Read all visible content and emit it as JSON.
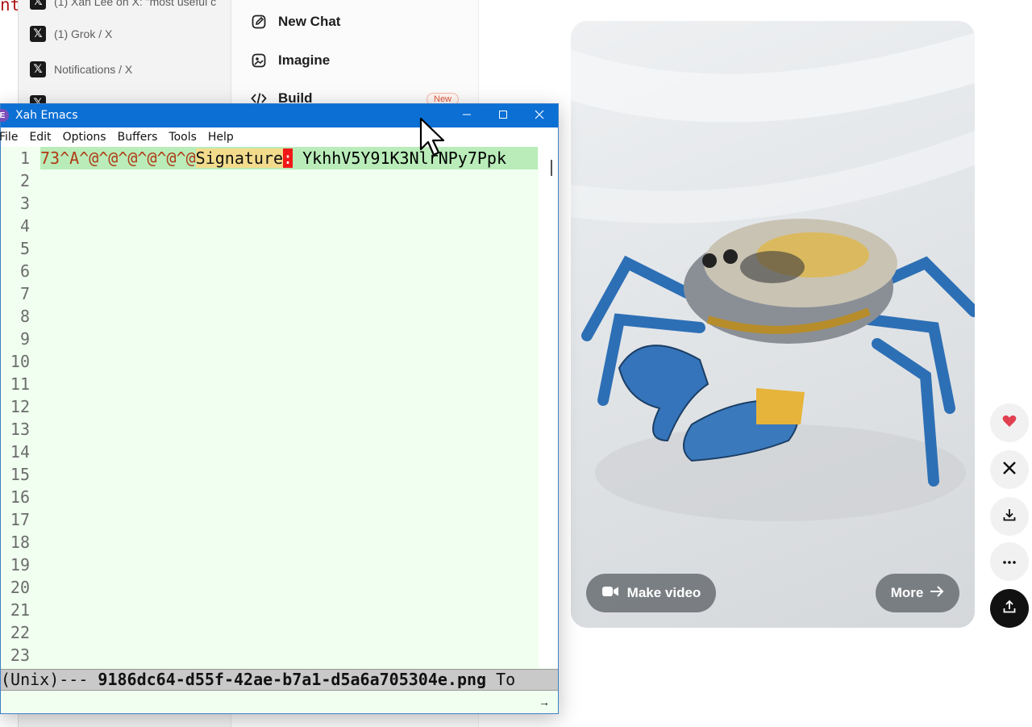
{
  "background": {
    "left_fragment": "nt",
    "tabs": [
      {
        "title": "(1) Xah Lee on X: \"most useful c",
        "icon": "x-logo-icon"
      },
      {
        "title": "(1) Grok / X",
        "icon": "x-logo-icon"
      },
      {
        "title": "Notifications / X",
        "icon": "x-logo-icon"
      },
      {
        "title": "",
        "icon": "x-logo-icon"
      }
    ],
    "grok_nav": [
      {
        "label": "New Chat",
        "icon": "edit-icon"
      },
      {
        "label": "Imagine",
        "icon": "imagine-icon"
      },
      {
        "label": "Build",
        "icon": "code-icon",
        "badge": "New"
      }
    ],
    "image_card": {
      "make_video_label": "Make video",
      "more_label": "More"
    },
    "side_actions": [
      "heart-icon",
      "x-share-icon",
      "download-icon",
      "more-dots-icon",
      "upload-icon"
    ]
  },
  "emacs": {
    "title": "Xah Emacs",
    "menu": [
      "File",
      "Edit",
      "Options",
      "Buffers",
      "Tools",
      "Help"
    ],
    "line_numbers": [
      "1",
      "2",
      "3",
      "4",
      "5",
      "6",
      "7",
      "8",
      "9",
      "10",
      "11",
      "12",
      "13",
      "14",
      "15",
      "16",
      "17",
      "18",
      "19",
      "20",
      "21",
      "22",
      "23"
    ],
    "line1": {
      "prefix": "73",
      "control_chars": "^A^@^@^@^@^@^@",
      "keyword": "Signature",
      "colon": ":",
      "value": " YkhhV5Y91K3NlrNPy7Ppk"
    },
    "modeline": {
      "left": "(Unix)--- ",
      "filename": "9186dc64-d55f-42ae-b7a1-d5a6a705304e.png",
      "right": " To"
    }
  },
  "colors": {
    "titlebar": "#0b6fd4",
    "editor_bg": "#f0fff0",
    "line_highlight": "#b9ecb9",
    "control_char": "#b03a14",
    "colon_highlight": "#f21818"
  }
}
